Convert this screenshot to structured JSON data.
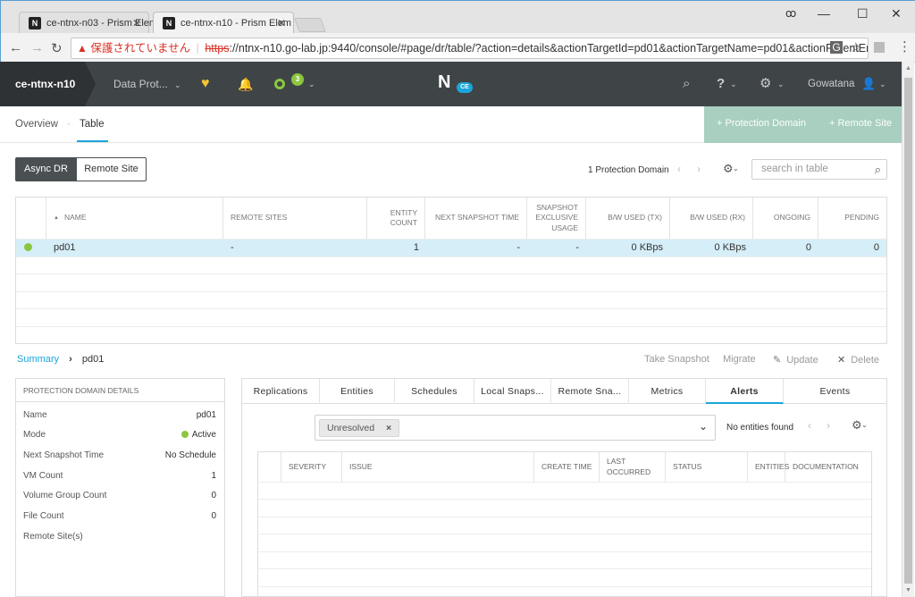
{
  "browser": {
    "tabs": [
      {
        "title": "ce-ntnx-n03 - Prism Elem",
        "active": false
      },
      {
        "title": "ce-ntnx-n10 - Prism Elem",
        "active": true
      }
    ],
    "security_warning": "保護されていません",
    "url_scheme": "https",
    "url_rest": "://ntnx-n10.go-lab.jp:9440/console/#page/dr/table/?action=details&actionTargetId=pd01&actionTargetName=pd01&actionParentEnti..."
  },
  "header": {
    "cluster_name": "ce-ntnx-n10",
    "menu_label": "Data Prot...",
    "task_count": "3",
    "logo_badge": "CE",
    "user": "Gowatana",
    "accent": "#4a4f52",
    "brand": "#a8cfc0",
    "link": "#1aa6d9"
  },
  "subnav": {
    "tabs": [
      "Overview",
      "Table"
    ],
    "separator": "·",
    "active_tab": "Table",
    "buttons": [
      "+ Protection Domain",
      "+ Remote Site"
    ]
  },
  "toolbar": {
    "segments": [
      "Async DR",
      "Remote Site"
    ],
    "count_text": "1 Protection Domain",
    "search_placeholder": "search in table"
  },
  "table": {
    "columns": [
      "NAME",
      "REMOTE SITES",
      "ENTITY COUNT",
      "NEXT SNAPSHOT TIME",
      "SNAPSHOT EXCLUSIVE USAGE",
      "B/W USED (TX)",
      "B/W USED (RX)",
      "ONGOING",
      "PENDING"
    ],
    "rows": [
      {
        "name": "pd01",
        "remote_sites": "-",
        "entity_count": "1",
        "next_snapshot": "-",
        "exclusive_usage": "-",
        "bw_tx": "0 KBps",
        "bw_rx": "0 KBps",
        "ongoing": "0",
        "pending": "0",
        "status_color": "#8cc63f"
      }
    ]
  },
  "breadcrumb": {
    "root": "Summary",
    "sep": "›",
    "current": "pd01"
  },
  "actions": [
    "Take Snapshot",
    "Migrate",
    "Update",
    "Delete"
  ],
  "details": {
    "title": "PROTECTION DOMAIN DETAILS",
    "rows": [
      {
        "label": "Name",
        "value": "pd01"
      },
      {
        "label": "Mode",
        "value": "Active"
      },
      {
        "label": "Next Snapshot Time",
        "value": "No Schedule"
      },
      {
        "label": "VM Count",
        "value": "1"
      },
      {
        "label": "Volume Group Count",
        "value": "0"
      },
      {
        "label": "File Count",
        "value": "0"
      },
      {
        "label": "Remote Site(s)",
        "value": ""
      }
    ]
  },
  "detail_tabs": {
    "tabs": [
      "Replications",
      "Entities",
      "Schedules",
      "Local Snaps...",
      "Remote Sna...",
      "Metrics",
      "Alerts",
      "Events"
    ],
    "active": "Alerts"
  },
  "alerts": {
    "filter_chip": "Unresolved",
    "status_text": "No entities found",
    "columns": [
      "SEVERITY",
      "ISSUE",
      "CREATE TIME",
      "LAST OCCURRED",
      "STATUS",
      "ENTITIES",
      "DOCUMENTATION"
    ]
  }
}
